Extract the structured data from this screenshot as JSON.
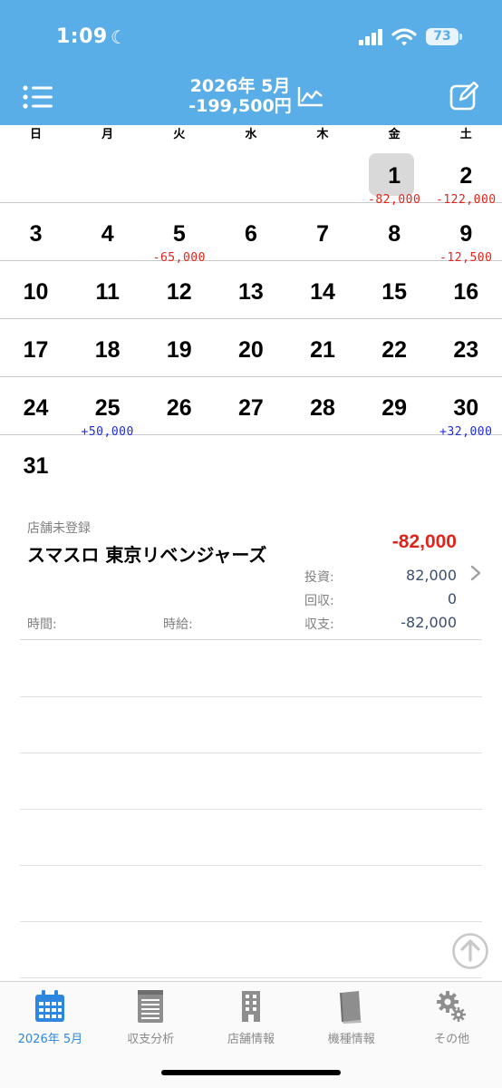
{
  "status_bar": {
    "time": "1:09",
    "battery": "73"
  },
  "header": {
    "title_month": "2026年 5月",
    "title_total": "-199,500円",
    "bg_color": "#5aaee8"
  },
  "weekdays": [
    "日",
    "月",
    "火",
    "水",
    "木",
    "金",
    "土"
  ],
  "calendar": {
    "selected_day": "1",
    "weeks": [
      [
        {
          "day": "",
          "amount": ""
        },
        {
          "day": "",
          "amount": ""
        },
        {
          "day": "",
          "amount": ""
        },
        {
          "day": "",
          "amount": ""
        },
        {
          "day": "",
          "amount": ""
        },
        {
          "day": "1",
          "amount": "-82,000"
        },
        {
          "day": "2",
          "amount": "-122,000"
        }
      ],
      [
        {
          "day": "3",
          "amount": ""
        },
        {
          "day": "4",
          "amount": ""
        },
        {
          "day": "5",
          "amount": "-65,000"
        },
        {
          "day": "6",
          "amount": ""
        },
        {
          "day": "7",
          "amount": ""
        },
        {
          "day": "8",
          "amount": ""
        },
        {
          "day": "9",
          "amount": "-12,500"
        }
      ],
      [
        {
          "day": "10",
          "amount": ""
        },
        {
          "day": "11",
          "amount": ""
        },
        {
          "day": "12",
          "amount": ""
        },
        {
          "day": "13",
          "amount": ""
        },
        {
          "day": "14",
          "amount": ""
        },
        {
          "day": "15",
          "amount": ""
        },
        {
          "day": "16",
          "amount": ""
        }
      ],
      [
        {
          "day": "17",
          "amount": ""
        },
        {
          "day": "18",
          "amount": ""
        },
        {
          "day": "19",
          "amount": ""
        },
        {
          "day": "20",
          "amount": ""
        },
        {
          "day": "21",
          "amount": ""
        },
        {
          "day": "22",
          "amount": ""
        },
        {
          "day": "23",
          "amount": ""
        }
      ],
      [
        {
          "day": "24",
          "amount": ""
        },
        {
          "day": "25",
          "amount": "+50,000"
        },
        {
          "day": "26",
          "amount": ""
        },
        {
          "day": "27",
          "amount": ""
        },
        {
          "day": "28",
          "amount": ""
        },
        {
          "day": "29",
          "amount": ""
        },
        {
          "day": "30",
          "amount": "+32,000"
        }
      ],
      [
        {
          "day": "31",
          "amount": ""
        },
        {
          "day": "",
          "amount": ""
        },
        {
          "day": "",
          "amount": ""
        },
        {
          "day": "",
          "amount": ""
        },
        {
          "day": "",
          "amount": ""
        },
        {
          "day": "",
          "amount": ""
        },
        {
          "day": "",
          "amount": ""
        }
      ]
    ]
  },
  "entry": {
    "shop_status": "店舗未登録",
    "machine": "スマスロ 東京リベンジャーズ",
    "result": "-82,000",
    "invest_label": "投資:",
    "invest_value": "82,000",
    "return_label": "回収:",
    "return_value": "0",
    "time_label": "時間:",
    "hourly_label": "時給:",
    "balance_label": "収支:",
    "balance_value": "-82,000"
  },
  "tabs": [
    {
      "label": "2026年 5月",
      "icon": "calendar-icon",
      "active": true
    },
    {
      "label": "収支分析",
      "icon": "notepad-icon",
      "active": false
    },
    {
      "label": "店舗情報",
      "icon": "building-icon",
      "active": false
    },
    {
      "label": "機種情報",
      "icon": "book-icon",
      "active": false
    },
    {
      "label": "その他",
      "icon": "gear-icon",
      "active": false
    }
  ],
  "colors": {
    "negative": "#e0241c",
    "positive": "#1f2bd6",
    "accent": "#2d86e0"
  }
}
